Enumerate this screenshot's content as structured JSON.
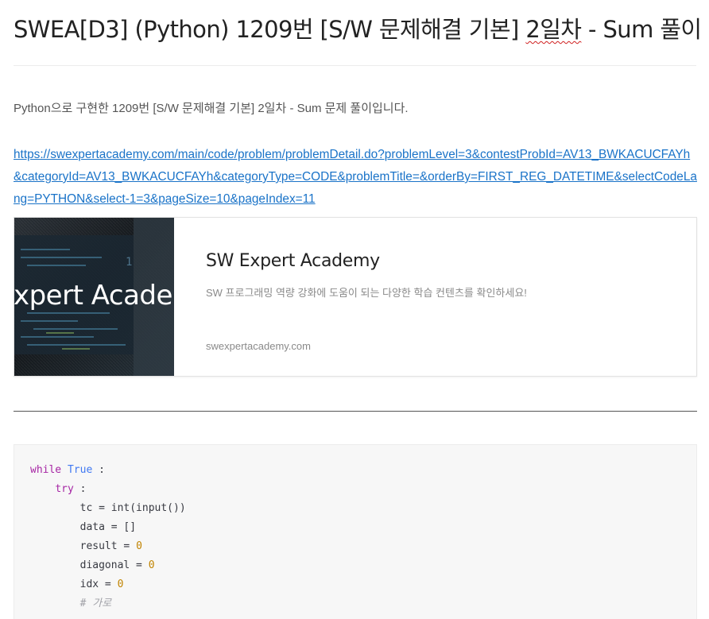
{
  "post": {
    "title": "SWEA[D3] (Python) 1209번 [S/W 문제해결 기본] 2일차 - Sum 풀이",
    "title_parts": {
      "before": "SWEA[D3] (Python) 1209번 [S/W 문제해결 기본] ",
      "flagged": "2일차",
      "after": " - Sum 풀이"
    },
    "intro": "Python으로 구현한 1209번 [S/W 문제해결 기본] 2일차 - Sum 문제 풀이입니다.",
    "link_text": "https://swexpertacademy.com/main/code/problem/problemDetail.do?problemLevel=3&contestProbId=AV13_BWKACUCFAYh&categoryId=AV13_BWKACUCFAYh&categoryType=CODE&problemTitle=&orderBy=FIRST_REG_DATETIME&selectCodeLang=PYTHON&select-1=3&pageSize=10&pageIndex=11"
  },
  "og_card": {
    "thumb_text": "Expert Academy",
    "title": "SW Expert Academy",
    "description": "SW 프로그래밍 역량 강화에 도움이 되는 다양한 학습 컨텐츠를 확인하세요!",
    "domain": "swexpertacademy.com"
  },
  "code": {
    "lines": [
      {
        "tokens": [
          {
            "t": "while",
            "k": "kw"
          },
          {
            "t": " ",
            "k": "plain"
          },
          {
            "t": "True",
            "k": "bool"
          },
          {
            "t": " :",
            "k": "plain"
          }
        ]
      },
      {
        "tokens": [
          {
            "t": "    ",
            "k": "plain"
          },
          {
            "t": "try",
            "k": "kw"
          },
          {
            "t": " :",
            "k": "plain"
          }
        ]
      },
      {
        "tokens": [
          {
            "t": "        tc = int(input())",
            "k": "plain"
          }
        ]
      },
      {
        "tokens": [
          {
            "t": "        data = []",
            "k": "plain"
          }
        ]
      },
      {
        "tokens": [
          {
            "t": "        result = ",
            "k": "plain"
          },
          {
            "t": "0",
            "k": "num"
          }
        ]
      },
      {
        "tokens": [
          {
            "t": "        diagonal = ",
            "k": "plain"
          },
          {
            "t": "0",
            "k": "num"
          }
        ]
      },
      {
        "tokens": [
          {
            "t": "        idx = ",
            "k": "plain"
          },
          {
            "t": "0",
            "k": "num"
          }
        ]
      },
      {
        "tokens": [
          {
            "t": "        ",
            "k": "plain"
          },
          {
            "t": "# 가로",
            "k": "comment"
          }
        ]
      }
    ]
  }
}
